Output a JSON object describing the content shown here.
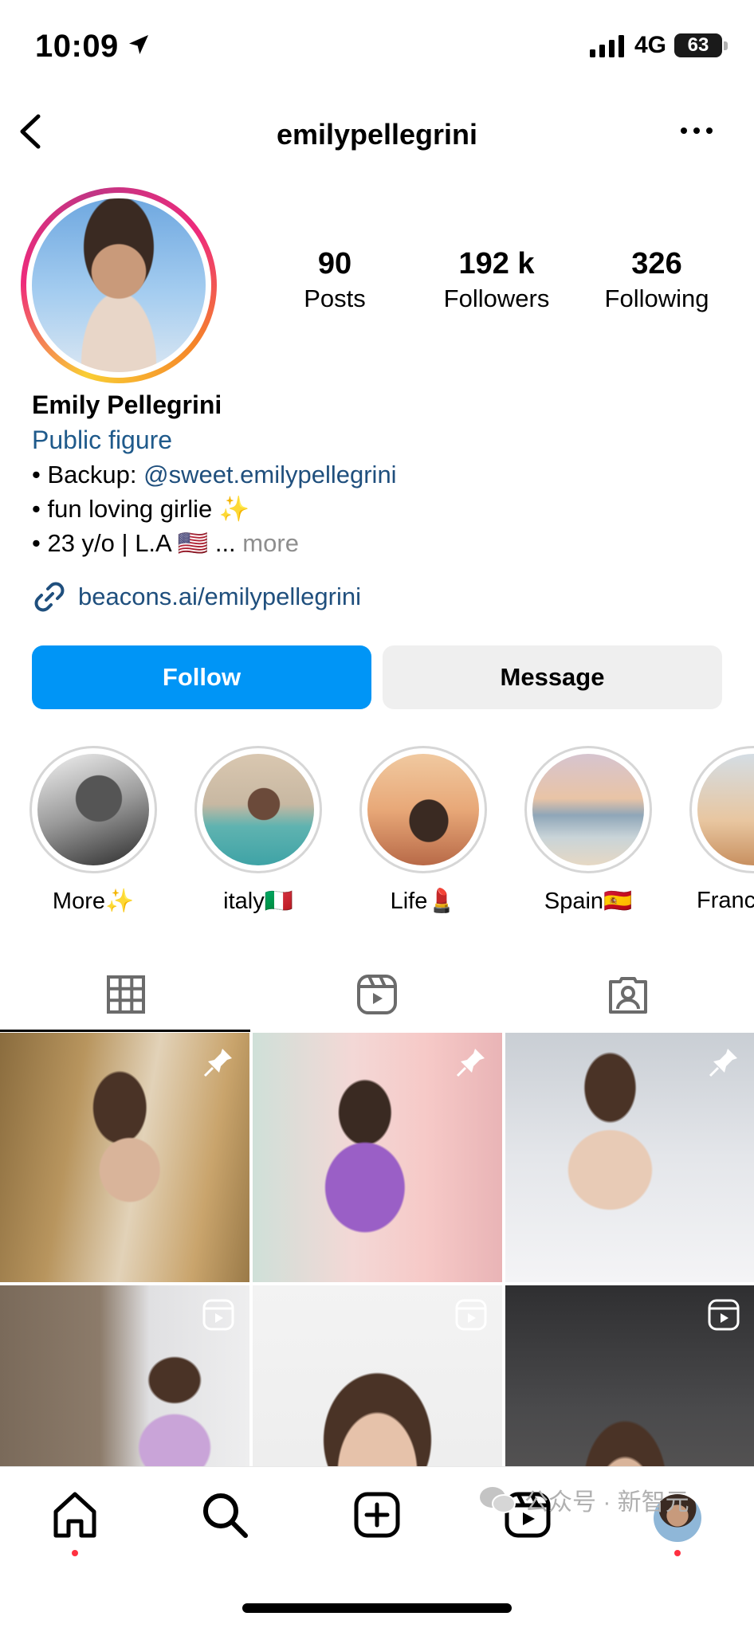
{
  "status_bar": {
    "time": "10:09",
    "network": "4G",
    "battery": "63"
  },
  "header": {
    "username": "emilypellegrini"
  },
  "profile": {
    "stats": [
      {
        "value": "90",
        "label": "Posts"
      },
      {
        "value": "192 k",
        "label": "Followers"
      },
      {
        "value": "326",
        "label": "Following"
      }
    ],
    "name": "Emily Pellegrini",
    "category": "Public figure",
    "bio": {
      "line1_prefix": "• Backup: ",
      "line1_mention": "@sweet.emilypellegrini",
      "line2": "• fun loving girlie ✨",
      "line3": "• 23 y/o | L.A 🇺🇸 ...",
      "line3_more": " more"
    },
    "link": "beacons.ai/emilypellegrini"
  },
  "buttons": {
    "follow": "Follow",
    "message": "Message"
  },
  "highlights": [
    {
      "label": "More✨"
    },
    {
      "label": "italy🇮🇹"
    },
    {
      "label": "Life💄"
    },
    {
      "label": "Spain🇪🇸"
    },
    {
      "label": "Franc"
    }
  ],
  "tabs": [
    "grid-icon",
    "reels-icon",
    "tagged-icon"
  ],
  "watermark": "公众号 · 新智元",
  "colors": {
    "follow_blue": "#0095f6",
    "link_blue": "#1f4f7d",
    "notification_red": "#ff3040"
  }
}
